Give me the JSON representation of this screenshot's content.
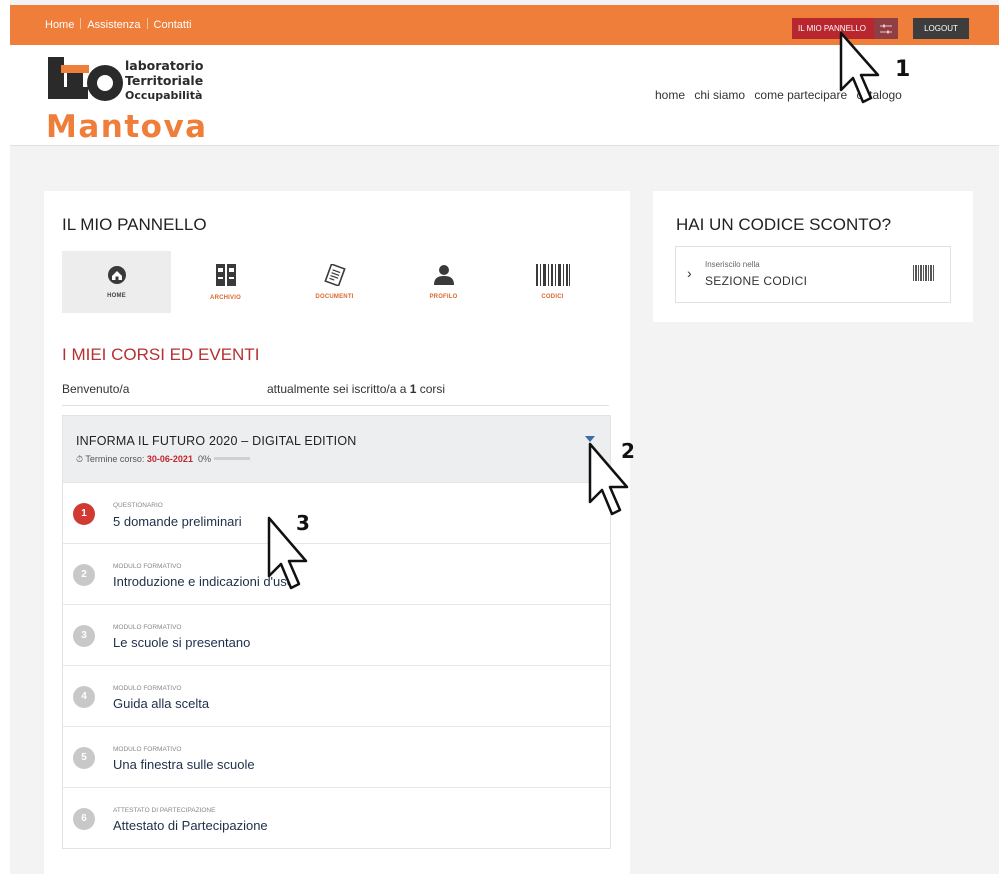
{
  "topbar": {
    "links": [
      "Home",
      "Assistenza",
      "Contatti"
    ],
    "panel_button": "IL MIO PANNELLO",
    "logout_button": "LOGOUT"
  },
  "header": {
    "logo": {
      "line1": "laboratorio",
      "line2": "Territoriale",
      "line3": "Occupabilità",
      "line4": "Mantova"
    },
    "nav": [
      "home",
      "chi siamo",
      "come partecipare",
      "catalogo"
    ]
  },
  "panel": {
    "title": "IL MIO PANNELLO",
    "tiles": [
      {
        "label": "HOME",
        "icon": "home-icon"
      },
      {
        "label": "ARCHIVIO",
        "icon": "archive-icon"
      },
      {
        "label": "DOCUMENTI",
        "icon": "documents-icon"
      },
      {
        "label": "PROFILO",
        "icon": "profile-icon"
      },
      {
        "label": "CODICI",
        "icon": "barcode-icon"
      }
    ]
  },
  "events": {
    "title": "I MIEI CORSI ED EVENTI",
    "welcome": "Benvenuto/a",
    "enrolled_prefix": "attualmente sei iscritto/a a ",
    "enrolled_count": "1",
    "enrolled_suffix": " corsi"
  },
  "course": {
    "title": "INFORMA IL FUTURO 2020 – DIGITAL EDITION",
    "deadline_label": "Termine corso: ",
    "deadline": "30-06-2021",
    "progress_text": "0%",
    "progress": 0,
    "items": [
      {
        "num": "1",
        "type": "QUESTIONARIO",
        "title": "5 domande preliminari"
      },
      {
        "num": "2",
        "type": "MODULO FORMATIVO",
        "title": "Introduzione e indicazioni d'uso"
      },
      {
        "num": "3",
        "type": "MODULO FORMATIVO",
        "title": "Le scuole si presentano"
      },
      {
        "num": "4",
        "type": "MODULO FORMATIVO",
        "title": "Guida alla scelta"
      },
      {
        "num": "5",
        "type": "MODULO FORMATIVO",
        "title": "Una finestra sulle scuole"
      },
      {
        "num": "6",
        "type": "ATTESTATO DI PARTECIPAZIONE",
        "title": "Attestato di Partecipazione"
      }
    ]
  },
  "discount": {
    "title": "HAI UN CODICE SCONTO?",
    "small": "Inseriscilo nella",
    "big": "SEZIONE CODICI"
  },
  "annotations": [
    "1",
    "2",
    "3"
  ],
  "colors": {
    "accent": "#ef7e3a",
    "panel_red": "#b8262e",
    "title_red": "#b73032",
    "logout": "#3d3d3d"
  }
}
